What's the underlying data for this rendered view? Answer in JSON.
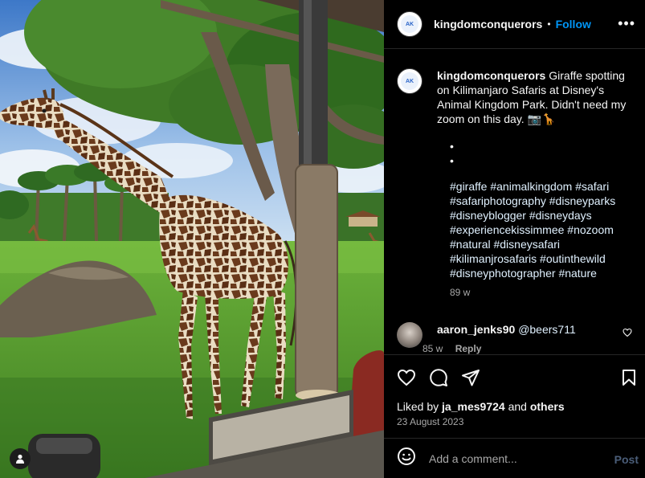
{
  "post": {
    "username": "kingdomconquerors",
    "follow_label": "Follow",
    "separator": "•",
    "more_label": "•••",
    "avatar_text": "AK",
    "caption_text": "Giraffe spotting on Kilimanjaro Safaris at Disney's Animal Kingdom Park. Didn't need my zoom on this day. 📷🦒",
    "bullets": [
      "•",
      "•"
    ],
    "hashtags": [
      "#giraffe",
      "#animalkingdom",
      "#safari",
      "#safariphotography",
      "#disneyparks",
      "#disneyblogger",
      "#disneydays",
      "#experiencekissimmee",
      "#nozoom",
      "#natural",
      "#disneysafari",
      "#kilimanjrosafaris",
      "#outinthewild",
      "#disneyphotographer",
      "#nature"
    ],
    "caption_time": "89 w"
  },
  "comment": {
    "username": "aaron_jenks90",
    "mention": "@beers711",
    "time": "85 w",
    "reply_label": "Reply"
  },
  "actions": {
    "liked_by_prefix": "Liked by",
    "liked_by_user": "ja_mes9724",
    "liked_by_and": "and",
    "liked_by_others": "others",
    "date": "23 August 2023"
  },
  "add_comment": {
    "placeholder": "Add a comment...",
    "post_label": "Post"
  },
  "icons": {
    "like": "heart-icon",
    "comment": "comment-bubble-icon",
    "share": "send-icon",
    "save": "bookmark-icon",
    "emoji": "emoji-icon",
    "more": "more-options-icon",
    "tag": "user-tag-icon"
  },
  "colors": {
    "accent": "#0095f6",
    "background": "#000000",
    "post_disabled": "#4a5d78"
  }
}
